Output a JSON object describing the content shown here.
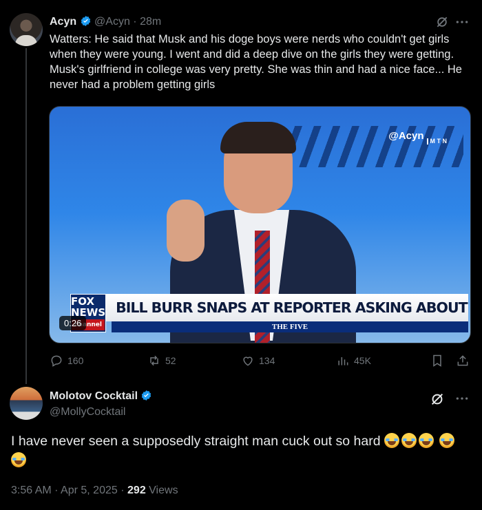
{
  "tweet": {
    "author": "Acyn",
    "handle": "@Acyn",
    "time": "28m",
    "text": "Watters: He said that Musk and his doge boys were nerds who couldn't get girls when they were young. I went and did a deep dive on the girls they were getting. Musk's girlfriend in college was very pretty. She was thin and had a nice face... He never had a problem getting girls",
    "media": {
      "watermark": "@Acyn",
      "watermark_sub": "M T N",
      "network_logo": "FOX NEWS",
      "network_sub": "channel",
      "headline": "BILL BURR SNAPS AT REPORTER ASKING ABOUT POLITICS",
      "show_name": "THE FIVE",
      "duration": "0:26"
    },
    "stats": {
      "replies": "160",
      "reposts": "52",
      "likes": "134",
      "views": "45K"
    }
  },
  "reply": {
    "author": "Molotov Cocktail",
    "handle": "@MollyCocktail",
    "text": "I have never seen a supposedly straight man cuck out so hard",
    "emoji_count": 5,
    "timestamp": "3:56 AM",
    "date": "Apr 5, 2025",
    "views_count": "292",
    "views_label": "Views"
  },
  "colors": {
    "background": "#000000",
    "text": "#e7e9ea",
    "muted": "#71767b",
    "verified": "#1d9bf0"
  },
  "icons": [
    "verified-badge-icon",
    "grok-icon",
    "more-icon",
    "reply-icon",
    "repost-icon",
    "like-icon",
    "views-icon",
    "bookmark-icon",
    "share-icon"
  ]
}
